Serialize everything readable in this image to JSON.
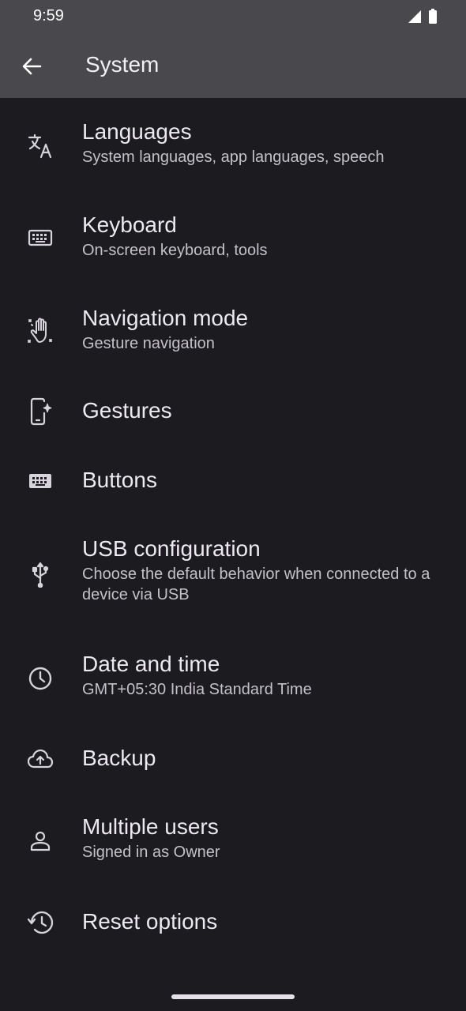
{
  "status_bar": {
    "time": "9:59",
    "icons": [
      "signal-icon",
      "battery-icon"
    ]
  },
  "header": {
    "title": "System",
    "back_icon": "back-arrow-icon"
  },
  "items": [
    {
      "title": "Languages",
      "subtitle": "System languages, app languages, speech",
      "icon": "translate-icon"
    },
    {
      "title": "Keyboard",
      "subtitle": "On-screen keyboard, tools",
      "icon": "keyboard-icon"
    },
    {
      "title": "Navigation mode",
      "subtitle": "Gesture navigation",
      "icon": "gesture-hand-icon"
    },
    {
      "title": "Gestures",
      "subtitle": "",
      "icon": "phone-sparkle-icon"
    },
    {
      "title": "Buttons",
      "subtitle": "",
      "icon": "buttons-keyboard-icon"
    },
    {
      "title": "USB configuration",
      "subtitle": "Choose the default behavior when connected to a device via USB",
      "icon": "usb-icon"
    },
    {
      "title": "Date and time",
      "subtitle": "GMT+05:30 India Standard Time",
      "icon": "clock-icon"
    },
    {
      "title": "Backup",
      "subtitle": "",
      "icon": "cloud-upload-icon"
    },
    {
      "title": "Multiple users",
      "subtitle": "Signed in as Owner",
      "icon": "person-icon"
    },
    {
      "title": "Reset options",
      "subtitle": "",
      "icon": "history-icon"
    }
  ],
  "colors": {
    "background": "#1c1b20",
    "top_bar": "#49484d",
    "title_text": "#ece9f0",
    "subtitle_text": "#c4c1c8"
  }
}
